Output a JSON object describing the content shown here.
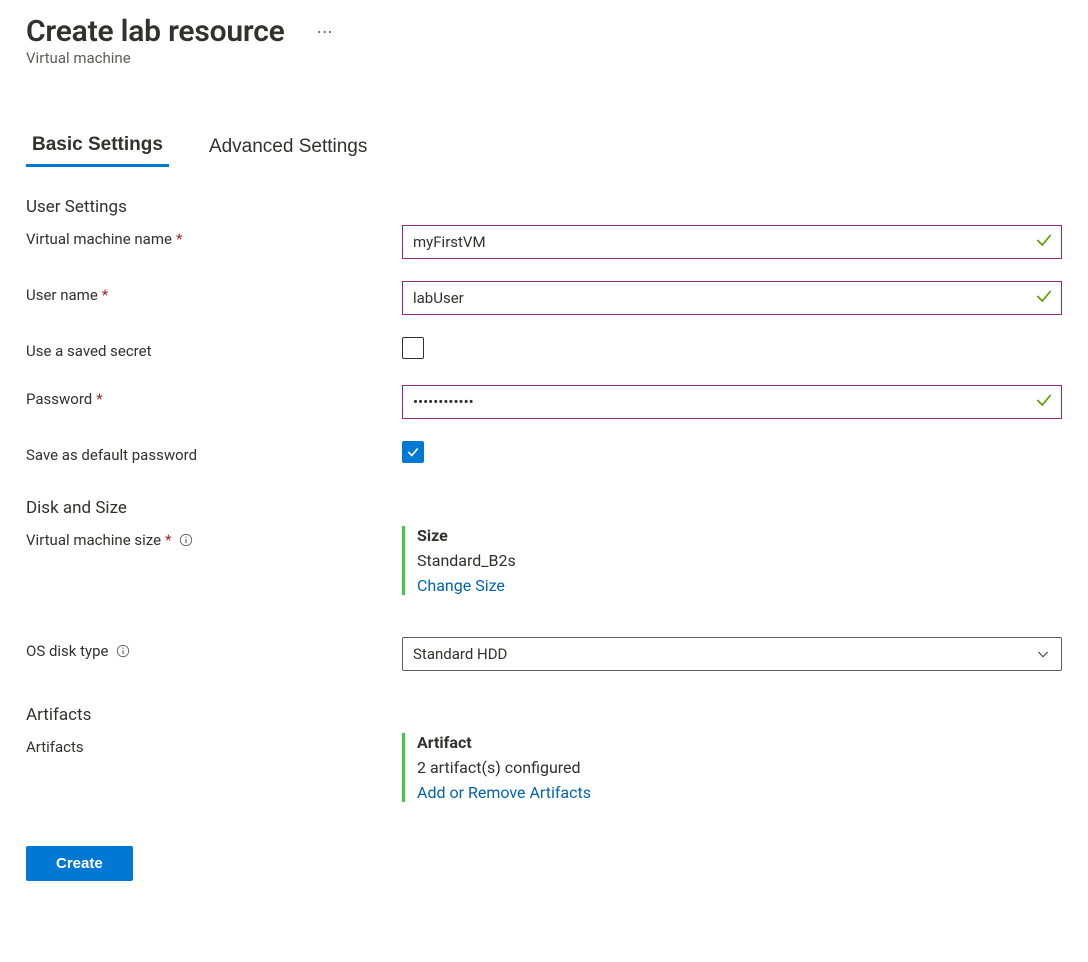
{
  "header": {
    "title": "Create lab resource",
    "subtitle": "Virtual machine"
  },
  "tabs": {
    "basic": "Basic Settings",
    "advanced": "Advanced Settings"
  },
  "sections": {
    "user": "User Settings",
    "disk": "Disk and Size",
    "artifacts": "Artifacts"
  },
  "fields": {
    "vm_name_label": "Virtual machine name",
    "vm_name_value": "myFirstVM",
    "user_name_label": "User name",
    "user_name_value": "labUser",
    "saved_secret_label": "Use a saved secret",
    "saved_secret_checked": false,
    "password_label": "Password",
    "password_value": "•••••••••••",
    "save_default_label": "Save as default password",
    "save_default_checked": true,
    "vm_size_label": "Virtual machine size",
    "os_disk_label": "OS disk type",
    "os_disk_value": "Standard HDD",
    "artifacts_label": "Artifacts"
  },
  "size_block": {
    "title": "Size",
    "value": "Standard_B2s",
    "link": "Change Size"
  },
  "artifact_block": {
    "title": "Artifact",
    "value": "2 artifact(s) configured",
    "link": "Add or Remove Artifacts"
  },
  "footer": {
    "create": "Create"
  }
}
